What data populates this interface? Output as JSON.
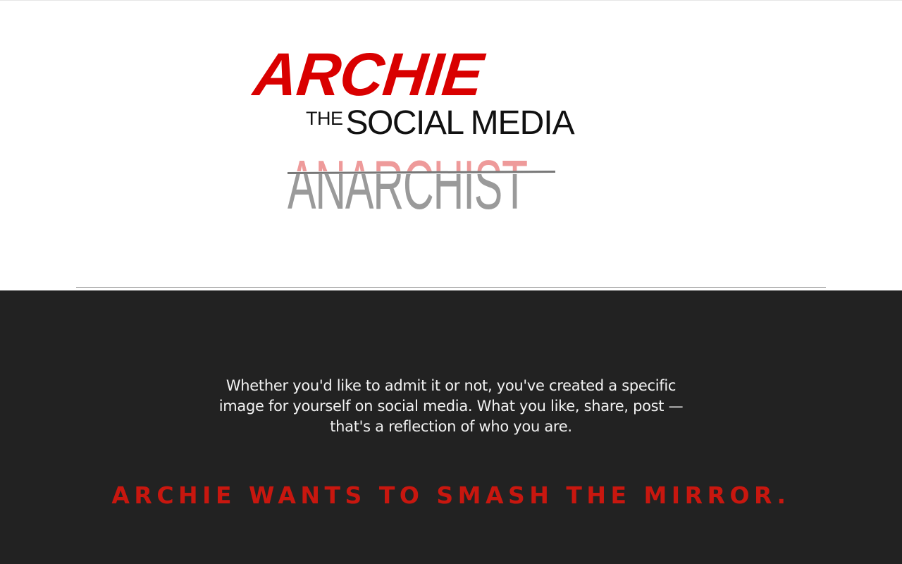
{
  "hero": {
    "logo": {
      "archie": "ARCHIE",
      "the": "THE",
      "social": "SOCIAL",
      "media": "MEDIA",
      "anarchist": "ANARCHIST"
    }
  },
  "main": {
    "intro": "Whether you'd like to admit it or not, you've created a specific image for yourself on social media. What you like, share, post — that's a reflection of who you are.",
    "tagline": "ARCHIE WANTS TO SMASH THE MIRROR."
  },
  "colors": {
    "brand_red": "#d90000",
    "tagline_red": "#c8170f",
    "dark_background": "#222222",
    "anarchist_gray": "#9a9a9a",
    "anarchist_pink": "#ee9a9a"
  }
}
